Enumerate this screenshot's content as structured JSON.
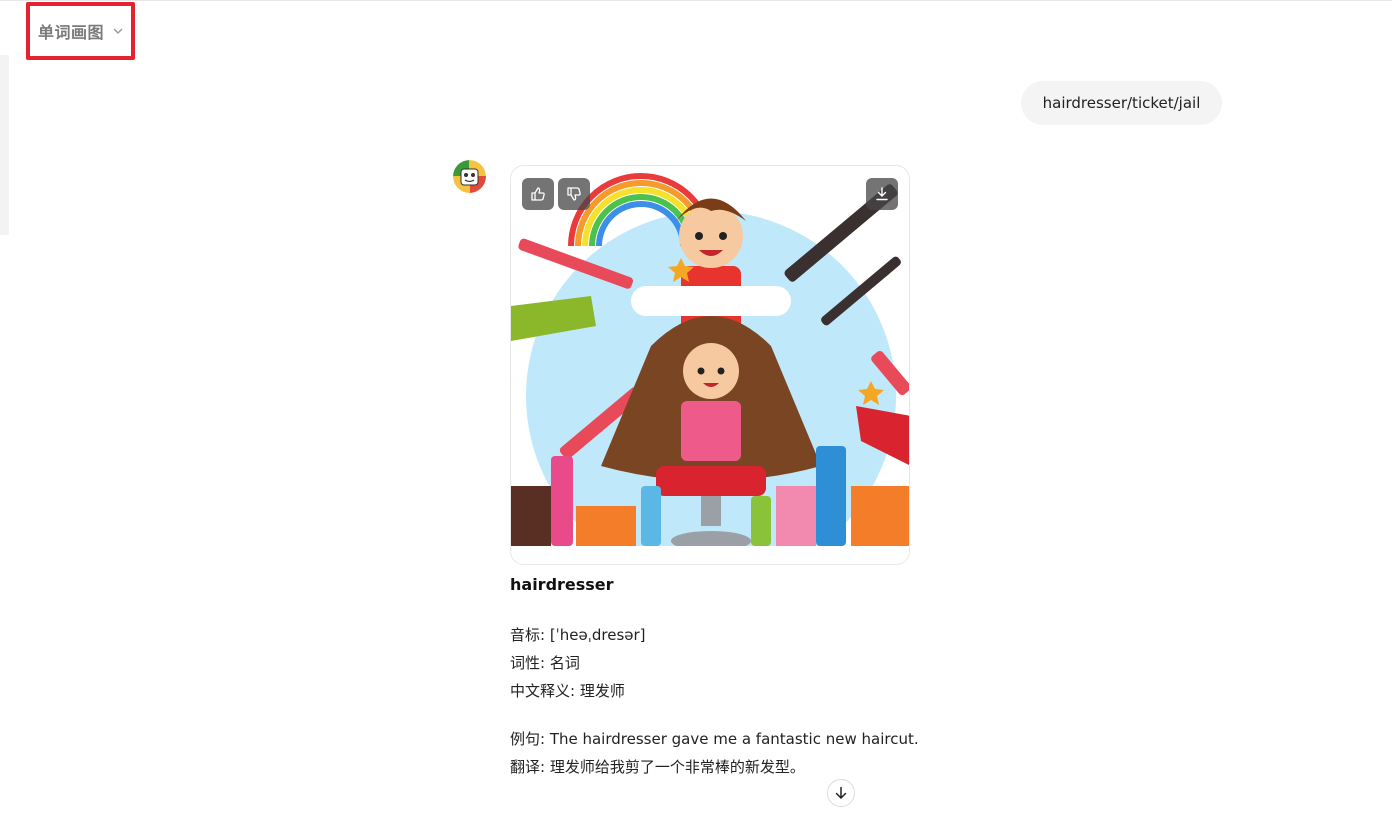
{
  "header": {
    "title": "单词画图",
    "dropdown_icon": "chevron-down-icon"
  },
  "conversation": {
    "user_message": "hairdresser/ticket/jail",
    "bot": {
      "avatar_icon": "bot-avatar",
      "image_actions": {
        "like_icon": "thumbs-up-icon",
        "dislike_icon": "thumbs-down-icon",
        "download_icon": "download-icon"
      },
      "word": "hairdresser",
      "phonetic": "音标: [ˈheəˌdresər]",
      "part_of_speech": "词性: 名词",
      "definition": "中文释义: 理发师",
      "example": "例句: The hairdresser gave me a fantastic new haircut.",
      "translation": "翻译: 理发师给我剪了一个非常棒的新发型。"
    }
  },
  "scroll_down_icon": "arrow-down-icon",
  "colors": {
    "highlight_border": "#e3232f",
    "bubble_bg": "#f4f4f4"
  }
}
